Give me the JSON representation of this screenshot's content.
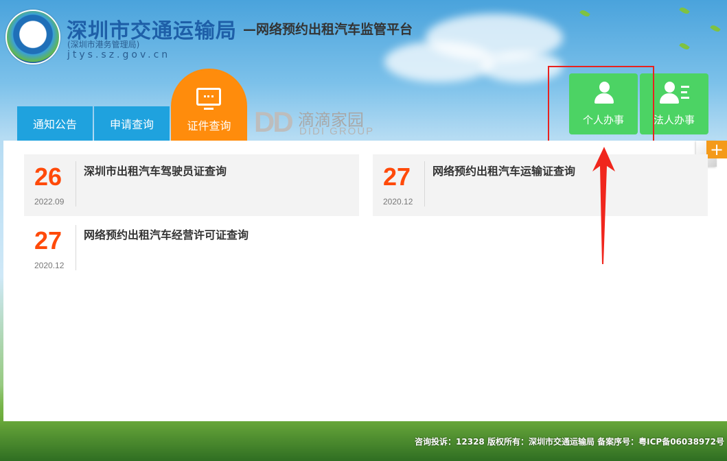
{
  "header": {
    "title": "深圳市交通运输局",
    "subtitle": "—网络预约出租汽车监管平台",
    "sub_org": "(深圳市港务管理局)",
    "domain": "jtys.sz.gov.cn"
  },
  "tabs": [
    {
      "label": "通知公告",
      "active": false
    },
    {
      "label": "申请查询",
      "active": false
    },
    {
      "label": "证件查询",
      "active": true
    }
  ],
  "didi": {
    "initials": "DD",
    "cn": "滴滴家园",
    "en": "DIDI GROUP"
  },
  "actions": {
    "personal": {
      "label": "个人办事",
      "icon": "person-icon"
    },
    "legal": {
      "label": "法人办事",
      "icon": "legal-person-icon"
    }
  },
  "items": [
    {
      "day": "26",
      "ym": "2022.09",
      "title": "深圳市出租汽车驾驶员证查询"
    },
    {
      "day": "27",
      "ym": "2020.12",
      "title": "网络预约出租汽车运输证查询"
    },
    {
      "day": "27",
      "ym": "2020.12",
      "title": "网络预约出租汽车经营许可证查询"
    }
  ],
  "corner": {
    "plus": "+"
  },
  "footer": {
    "text": "咨询投诉：12328  版权所有：深圳市交通运输局 备案序号：粤ICP备06038972号"
  },
  "colors": {
    "tab_blue": "#1fa2de",
    "tab_orange": "#ff8c0c",
    "action_green": "#4cd364",
    "date_red": "#ff4a0a",
    "highlight_red": "#e8221f"
  }
}
